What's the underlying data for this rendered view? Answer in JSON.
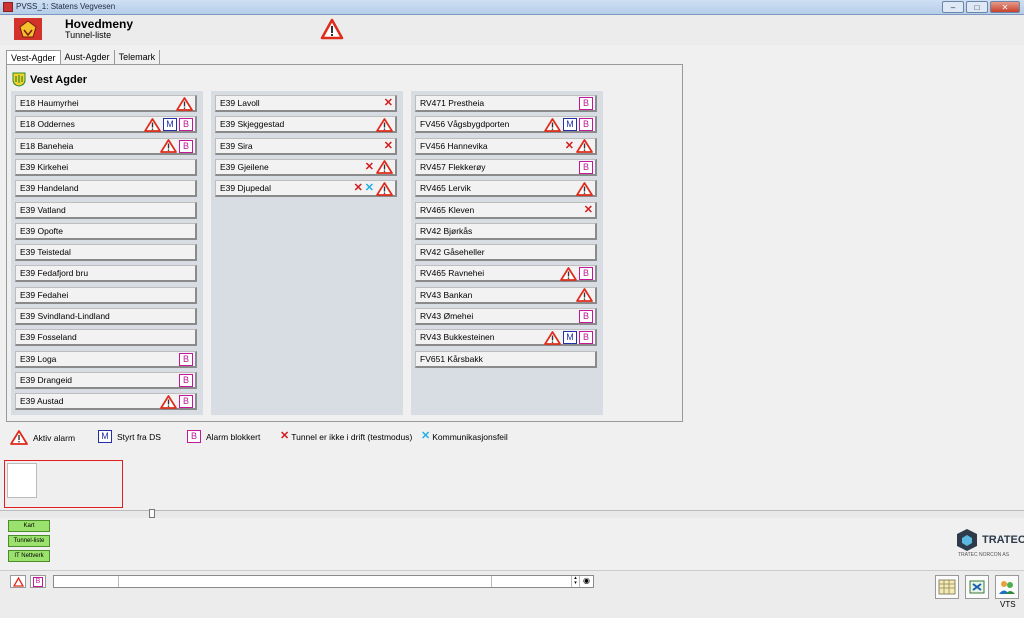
{
  "window": {
    "title": "PVSS_1: Statens Vegvesen",
    "min": "–",
    "max": "□",
    "close": "✕"
  },
  "header": {
    "title": "Hovedmeny",
    "subtitle": "Tunnel-liste"
  },
  "tabs": [
    "Vest-Agder",
    "Aust-Agder",
    "Telemark"
  ],
  "region": {
    "name": "Vest Agder"
  },
  "columns": [
    [
      {
        "name": "E18 Haumyrhei",
        "icons": [
          "alarm"
        ]
      },
      {
        "name": "E18 Oddernes",
        "icons": [
          "alarm",
          "M",
          "B"
        ]
      },
      {
        "name": "E18 Baneheia",
        "icons": [
          "alarm",
          "B"
        ]
      },
      {
        "name": "E39 Kirkehei",
        "icons": []
      },
      {
        "name": "E39 Handeland",
        "icons": []
      },
      {
        "name": "E39 Vatland",
        "icons": []
      },
      {
        "name": "E39 Opofte",
        "icons": []
      },
      {
        "name": "E39 Teistedal",
        "icons": []
      },
      {
        "name": "E39 Fedafjord bru",
        "icons": []
      },
      {
        "name": "E39 Fedahei",
        "icons": []
      },
      {
        "name": "E39 Svindland-Lindland",
        "icons": []
      },
      {
        "name": "E39 Fosseland",
        "icons": []
      },
      {
        "name": "E39 Loga",
        "icons": [
          "B"
        ]
      },
      {
        "name": "E39 Drangeid",
        "icons": [
          "B"
        ]
      },
      {
        "name": "E39 Austad",
        "icons": [
          "alarm",
          "B"
        ]
      }
    ],
    [
      {
        "name": "E39 Lavoll",
        "icons": [
          "x"
        ]
      },
      {
        "name": "E39 Skjeggestad",
        "icons": [
          "alarm"
        ]
      },
      {
        "name": "E39 Sira",
        "icons": [
          "x"
        ]
      },
      {
        "name": "E39 Gjeilene",
        "icons": [
          "x",
          "alarm"
        ]
      },
      {
        "name": "E39 Djupedal",
        "icons": [
          "x",
          "xc",
          "alarm"
        ]
      }
    ],
    [
      {
        "name": "RV471 Prestheia",
        "icons": [
          "B"
        ]
      },
      {
        "name": "FV456 Vågsbygdporten",
        "icons": [
          "alarm",
          "M",
          "B"
        ]
      },
      {
        "name": "FV456 Hannevika",
        "icons": [
          "x",
          "alarm"
        ]
      },
      {
        "name": "RV457 Flekkerøy",
        "icons": [
          "B"
        ]
      },
      {
        "name": "RV465 Lervik",
        "icons": [
          "alarm"
        ]
      },
      {
        "name": "RV465 Kleven",
        "icons": [
          "x"
        ]
      },
      {
        "name": "RV42 Bjørkås",
        "icons": []
      },
      {
        "name": "RV42 Gåseheller",
        "icons": []
      },
      {
        "name": "RV465 Ravnehei",
        "icons": [
          "alarm",
          "B"
        ]
      },
      {
        "name": "RV43 Bankan",
        "icons": [
          "alarm"
        ]
      },
      {
        "name": "RV43 Ømehei",
        "icons": [
          "B"
        ]
      },
      {
        "name": "RV43 Bukkesteinen",
        "icons": [
          "alarm",
          "M",
          "B"
        ]
      },
      {
        "name": "FV651 Kårsbakk",
        "icons": []
      }
    ]
  ],
  "legend": {
    "alarm": "Aktiv alarm",
    "m": "Styrt fra DS",
    "b": "Alarm blokkert",
    "x": "Tunnel er ikke i drift (testmodus)",
    "xc": "Kommunikasjonsfeil"
  },
  "glyphs": {
    "m": "M",
    "b": "B",
    "x": "✕"
  },
  "nav": [
    "Kart",
    "Tunnel-liste",
    "IT Nettverk"
  ],
  "brand": {
    "name": "TRATEC",
    "sub": "TRATEC NORCON AS"
  },
  "footer": {
    "vts": "VTS"
  },
  "colors": {
    "alarm": "#e02a1a",
    "blocked": "#c2189a",
    "manual": "#2230a8",
    "commfail": "#22b0e6",
    "nav_green": "#9be16d"
  }
}
